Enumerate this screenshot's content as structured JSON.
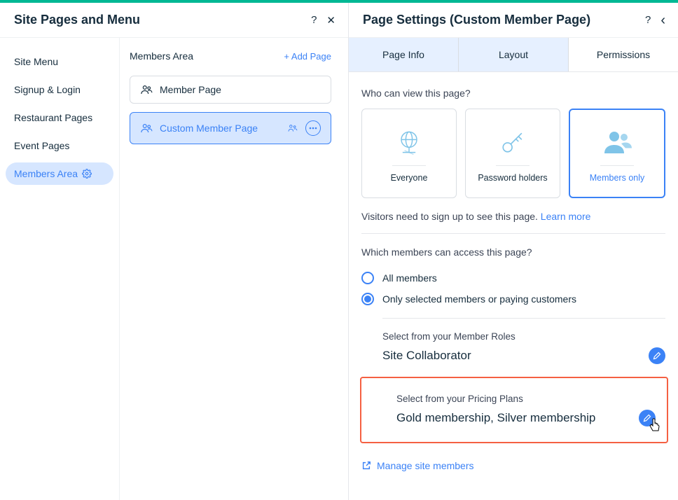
{
  "left_panel": {
    "title": "Site Pages and Menu",
    "help": "?",
    "close": "✕"
  },
  "sidebar": {
    "items": [
      {
        "label": "Site Menu"
      },
      {
        "label": "Signup & Login"
      },
      {
        "label": "Restaurant Pages"
      },
      {
        "label": "Event Pages"
      },
      {
        "label": "Members Area",
        "active": true
      }
    ]
  },
  "pages": {
    "heading": "Members Area",
    "add_label": "+  Add Page",
    "items": [
      {
        "label": "Member Page"
      },
      {
        "label": "Custom Member Page",
        "active": true
      }
    ]
  },
  "right_panel": {
    "title": "Page Settings (Custom Member Page)",
    "help": "?",
    "back": "‹"
  },
  "tabs": {
    "items": [
      {
        "label": "Page Info"
      },
      {
        "label": "Layout"
      },
      {
        "label": "Permissions",
        "active": true
      }
    ]
  },
  "permissions": {
    "who_label": "Who can view this page?",
    "cards": [
      {
        "label": "Everyone"
      },
      {
        "label": "Password holders"
      },
      {
        "label": "Members only",
        "active": true
      }
    ],
    "info_text": "Visitors need to sign up to see this page. ",
    "learn_more": "Learn more",
    "which_label": "Which members can access this page?",
    "radios": [
      {
        "label": "All members"
      },
      {
        "label": "Only selected members or paying customers",
        "selected": true
      }
    ],
    "roles_label": "Select from your Member Roles",
    "roles_value": "Site Collaborator",
    "plans_label": "Select from your Pricing Plans",
    "plans_value": "Gold membership, Silver membership",
    "manage_label": "Manage site members"
  }
}
